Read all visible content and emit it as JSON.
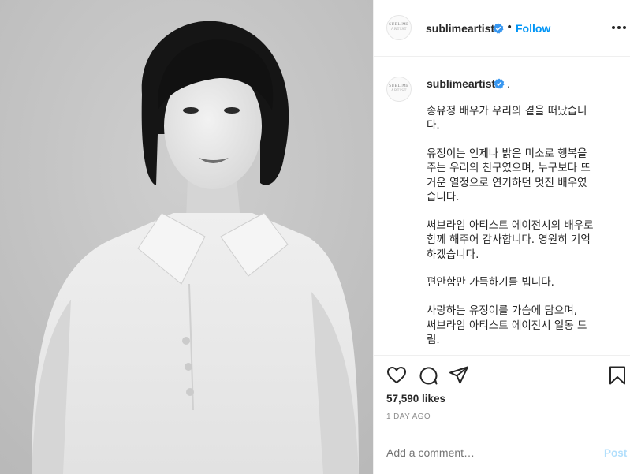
{
  "post": {
    "photo_alt": "black-and-white portrait",
    "header": {
      "username": "sublimeartist",
      "separator": "•",
      "follow_label": "Follow",
      "avatar_logo_line1": "SUBLIME",
      "avatar_logo_line2": "ARTIST"
    },
    "caption": {
      "username": "sublimeartist",
      "after_badge": ".",
      "lines": [
        "송유정 배우가 우리의 곁을 떠났습니",
        "다.",
        "",
        "유정이는 언제나 밝은 미소로 행복을",
        "주는 우리의 친구였으며, 누구보다 뜨",
        "거운 열정으로 연기하던 멋진 배우였",
        "습니다.",
        "",
        "써브라임 아티스트 에이전시의 배우로",
        "함께 해주어 감사합니다. 영원히 기억",
        "하겠습니다.",
        "",
        "편안함만 가득하기를 빕니다.",
        "",
        "사랑하는 유정이를 가슴에 담으며,",
        "써브라임 아티스트 에이전시 일동 드",
        "림."
      ]
    },
    "likes": "57,590 likes",
    "time_ago": "1 DAY AGO",
    "comment_placeholder": "Add a comment…",
    "post_label": "Post"
  },
  "colors": {
    "accent": "#0095f6",
    "post_disabled": "#b2dffc",
    "text": "#262626",
    "muted": "#8e8e8e",
    "border": "#efefef"
  },
  "icons": [
    "verified-badge-icon",
    "more-options-icon",
    "heart-icon",
    "comment-icon",
    "share-icon",
    "bookmark-icon"
  ]
}
